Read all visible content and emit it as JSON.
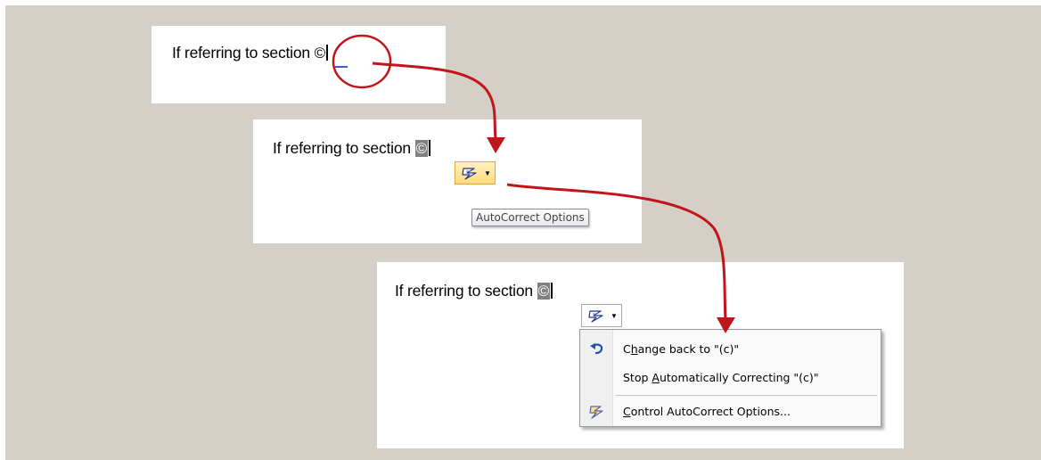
{
  "document_text": "If referring to section ",
  "symbol": "©",
  "tooltip": "AutoCorrect Options",
  "icons": {
    "autocorrect_button": "lightning-icon",
    "dropdown": "chevron-down-icon",
    "undo": "undo-icon",
    "control_options": "lightning-icon"
  },
  "menu": {
    "items": [
      {
        "pre": "C",
        "key": "h",
        "post": "ange back to \"(c)\""
      },
      {
        "pre": "Stop ",
        "key": "A",
        "post": "utomatically Correcting \"(c)\""
      },
      {
        "pre": "",
        "key": "C",
        "post": "ontrol AutoCorrect Options..."
      }
    ]
  },
  "colors": {
    "background": "#d4d0c8",
    "annotation_red": "#c0151b",
    "hover_gold": "#ffd97a",
    "autocorrect_underline": "#3c5ad6"
  }
}
